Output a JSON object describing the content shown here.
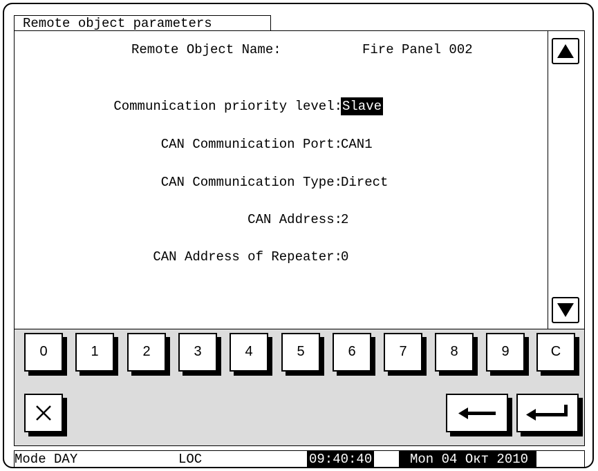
{
  "window": {
    "title": "Remote object parameters"
  },
  "header": {
    "label": "Remote Object Name:",
    "value": "Fire Panel 002"
  },
  "fields": [
    {
      "label": "Communication priority level:",
      "value": "Slave"
    },
    {
      "label": "CAN Communication Port:",
      "value": "CAN1"
    },
    {
      "label": "CAN Communication Type:",
      "value": "Direct"
    },
    {
      "label": "CAN Address:",
      "value": "2"
    },
    {
      "label": "CAN Address of Repeater:",
      "value": "0"
    }
  ],
  "scroll": {
    "up_icon": "triangle-up-icon",
    "down_icon": "triangle-down-icon"
  },
  "keypad": {
    "keys": [
      "0",
      "1",
      "2",
      "3",
      "4",
      "5",
      "6",
      "7",
      "8",
      "9",
      "C"
    ],
    "cancel_icon": "close-x-icon",
    "backspace_icon": "backspace-arrow-icon",
    "enter_icon": "enter-return-icon"
  },
  "status": {
    "mode": "Mode DAY",
    "location": "LOC",
    "time": "09:40:40",
    "date": "Mon 04 Окт 2010"
  }
}
